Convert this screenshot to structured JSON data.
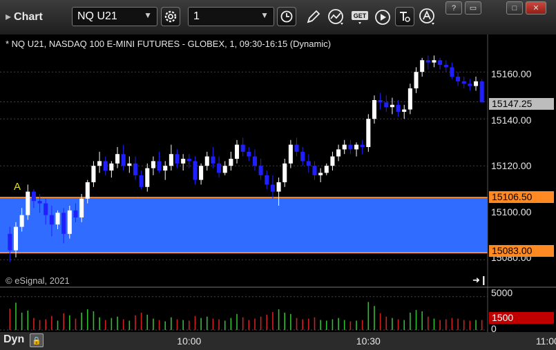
{
  "app": {
    "title": "Chart",
    "symbol": "NQ U21",
    "interval": "1"
  },
  "toolbar": {
    "icons": [
      "settings-gear-icon",
      "clock-icon",
      "pencil-icon",
      "study-icon",
      "get-icon",
      "play-icon",
      "text-icon",
      "alert-icon"
    ],
    "get_label": "GET"
  },
  "window": {
    "controls": [
      "help-icon",
      "restore-icon",
      "maximize-icon",
      "close-icon"
    ]
  },
  "colors": {
    "up": "#ffffff",
    "down": "#2020ff",
    "zone": "#2f6cff",
    "zone_line": "#ff8a24",
    "volume_up": "#2fc02f",
    "volume_down": "#d02020"
  },
  "chart_data": {
    "type": "candlestick",
    "title": "* NQ U21, NASDAQ 100 E-MINI FUTURES - GLOBEX, 1, 09:30-16:15 (Dynamic)",
    "copyright": "© eSignal, 2021",
    "annotation": "A",
    "ylim": [
      15073,
      15173
    ],
    "yticks": [
      "15160.00",
      "15140.00",
      "15120.00",
      "15100.00",
      "15080.00"
    ],
    "ytick_values": [
      15160,
      15140,
      15120,
      15100,
      15080
    ],
    "last_price": {
      "value": 15147.25,
      "label": "15147.25"
    },
    "zone": {
      "high": 15106.5,
      "low": 15083.0,
      "high_label": "15106.50",
      "low_label": "15083.00"
    },
    "xtick_labels": [
      "10:00",
      "10:30",
      "11:00"
    ],
    "xtick_minutes": [
      30,
      60,
      90
    ],
    "x_start_time": "09:30",
    "grid": true,
    "candles": [
      [
        15091,
        15094,
        15079,
        15084
      ],
      [
        15084,
        15096,
        15081,
        15094
      ],
      [
        15094,
        15102,
        15092,
        15099
      ],
      [
        15099,
        15112,
        15097,
        15109
      ],
      [
        15109,
        15110,
        15102,
        15105
      ],
      [
        15105,
        15108,
        15100,
        15104
      ],
      [
        15104,
        15106,
        15095,
        15099
      ],
      [
        15099,
        15103,
        15090,
        15095
      ],
      [
        15095,
        15101,
        15093,
        15100
      ],
      [
        15100,
        15102,
        15087,
        15091
      ],
      [
        15091,
        15103,
        15089,
        15101
      ],
      [
        15101,
        15104,
        15096,
        15098
      ],
      [
        15098,
        15108,
        15096,
        15106
      ],
      [
        15106,
        15114,
        15104,
        15113
      ],
      [
        15113,
        15122,
        15111,
        15120
      ],
      [
        15120,
        15126,
        15117,
        15122
      ],
      [
        15122,
        15124,
        15116,
        15118
      ],
      [
        15118,
        15122,
        15115,
        15121
      ],
      [
        15121,
        15128,
        15119,
        15125
      ],
      [
        15125,
        15129,
        15118,
        15120
      ],
      [
        15120,
        15124,
        15117,
        15121
      ],
      [
        15121,
        15124,
        15114,
        15116
      ],
      [
        15116,
        15118,
        15110,
        15111
      ],
      [
        15111,
        15121,
        15109,
        15119
      ],
      [
        15119,
        15124,
        15116,
        15122
      ],
      [
        15122,
        15126,
        15117,
        15118
      ],
      [
        15118,
        15122,
        15114,
        15120
      ],
      [
        15120,
        15129,
        15118,
        15125
      ],
      [
        15125,
        15127,
        15119,
        15121
      ],
      [
        15121,
        15125,
        15118,
        15123
      ],
      [
        15123,
        15125,
        15119,
        15122
      ],
      [
        15122,
        15124,
        15112,
        15114
      ],
      [
        15114,
        15121,
        15112,
        15120
      ],
      [
        15120,
        15126,
        15118,
        15124
      ],
      [
        15124,
        15128,
        15119,
        15121
      ],
      [
        15121,
        15124,
        15115,
        15117
      ],
      [
        15117,
        15122,
        15116,
        15120
      ],
      [
        15120,
        15126,
        15118,
        15123
      ],
      [
        15123,
        15131,
        15121,
        15129
      ],
      [
        15129,
        15132,
        15124,
        15126
      ],
      [
        15126,
        15128,
        15122,
        15124
      ],
      [
        15124,
        15127,
        15118,
        15120
      ],
      [
        15120,
        15123,
        15114,
        15116
      ],
      [
        15116,
        15118,
        15110,
        15112
      ],
      [
        15112,
        15116,
        15106,
        15109
      ],
      [
        15109,
        15115,
        15103,
        15113
      ],
      [
        15113,
        15123,
        15111,
        15121
      ],
      [
        15121,
        15131,
        15119,
        15129
      ],
      [
        15129,
        15132,
        15124,
        15126
      ],
      [
        15126,
        15128,
        15120,
        15122
      ],
      [
        15122,
        15125,
        15117,
        15120
      ],
      [
        15120,
        15122,
        15114,
        15116
      ],
      [
        15116,
        15119,
        15113,
        15117
      ],
      [
        15117,
        15121,
        15116,
        15120
      ],
      [
        15120,
        15126,
        15118,
        15124
      ],
      [
        15124,
        15129,
        15122,
        15127
      ],
      [
        15127,
        15131,
        15125,
        15129
      ],
      [
        15129,
        15131,
        15125,
        15127
      ],
      [
        15127,
        15130,
        15124,
        15129
      ],
      [
        15129,
        15131,
        15125,
        15128
      ],
      [
        15128,
        15142,
        15126,
        15140
      ],
      [
        15140,
        15150,
        15138,
        15148
      ],
      [
        15148,
        15151,
        15144,
        15147
      ],
      [
        15147,
        15150,
        15143,
        15145
      ],
      [
        15145,
        15149,
        15142,
        15146
      ],
      [
        15146,
        15148,
        15141,
        15143
      ],
      [
        15143,
        15146,
        15140,
        15144
      ],
      [
        15144,
        15155,
        15142,
        15153
      ],
      [
        15153,
        15162,
        15151,
        15160
      ],
      [
        15160,
        15166,
        15158,
        15165
      ],
      [
        15165,
        15167,
        15161,
        15164
      ],
      [
        15164,
        15167,
        15162,
        15165
      ],
      [
        15165,
        15166,
        15161,
        15163
      ],
      [
        15163,
        15165,
        15160,
        15162
      ],
      [
        15162,
        15164,
        15157,
        15158
      ],
      [
        15158,
        15160,
        15154,
        15156
      ],
      [
        15156,
        15158,
        15153,
        15155
      ],
      [
        15155,
        15157,
        15152,
        15154
      ],
      [
        15154,
        15158,
        15152,
        15156
      ],
      [
        15156,
        15157,
        15150,
        15147
      ]
    ],
    "volume": {
      "ylim": [
        0,
        5800
      ],
      "yticks": [
        "5000",
        "0"
      ],
      "ytick_values": [
        5000,
        0
      ],
      "last_label": "1500",
      "last_value": 1500,
      "values": [
        3200,
        4100,
        2600,
        2900,
        1800,
        1500,
        1600,
        2100,
        1400,
        2500,
        2200,
        1700,
        2600,
        3100,
        2800,
        1900,
        1500,
        1800,
        2000,
        1600,
        1400,
        2200,
        2600,
        2300,
        1700,
        1500,
        1300,
        1900,
        1600,
        1500,
        1400,
        2100,
        1800,
        2000,
        1700,
        1600,
        1400,
        1800,
        2400,
        1900,
        1500,
        1700,
        2000,
        2300,
        2700,
        3100,
        2600,
        2400,
        1800,
        1600,
        1700,
        1900,
        1500,
        1400,
        1600,
        1800,
        1500,
        1300,
        1400,
        1500,
        4200,
        3600,
        2500,
        2000,
        1800,
        1600,
        1500,
        2600,
        3000,
        2800,
        2000,
        1700,
        1500,
        1600,
        1800,
        1700,
        1500,
        1400,
        1500,
        1500
      ]
    }
  },
  "status": {
    "mode_label": "Dyn"
  }
}
